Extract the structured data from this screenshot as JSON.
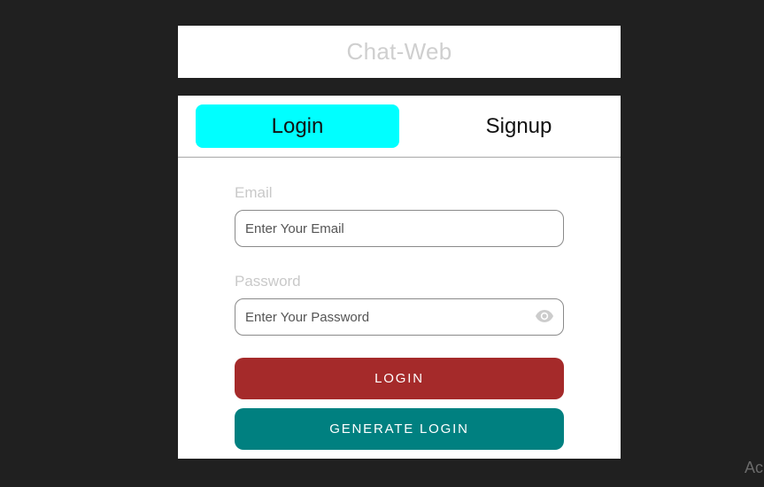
{
  "app": {
    "title": "Chat-Web"
  },
  "tabs": [
    {
      "label": "Login",
      "active": true
    },
    {
      "label": "Signup",
      "active": false
    }
  ],
  "form": {
    "email": {
      "label": "Email",
      "placeholder": "Enter Your Email",
      "value": ""
    },
    "password": {
      "label": "Password",
      "placeholder": "Enter Your Password",
      "value": "",
      "toggle_icon": "eye-icon"
    },
    "login_button": "LOGIN",
    "generate_button": "GENERATE LOGIN"
  },
  "colors": {
    "background": "#202020",
    "active_tab": "#00ffff",
    "login_button": "#a52a2a",
    "generate_button": "#008080"
  },
  "os_overlay": {
    "text": "Ac"
  }
}
